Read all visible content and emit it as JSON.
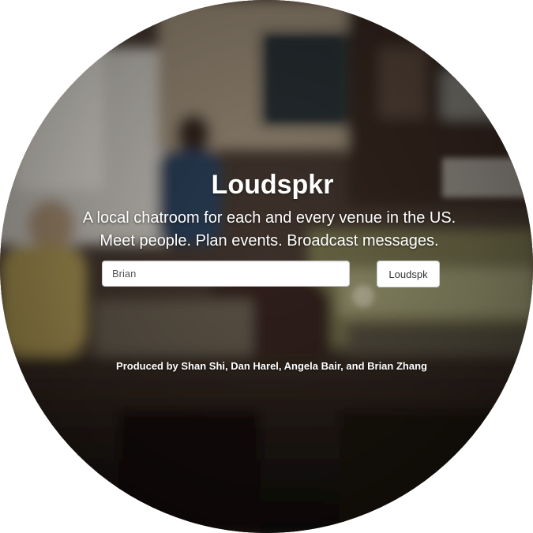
{
  "hero": {
    "title": "Loudspkr",
    "tagline_line1": "A local chatroom for each and every venue in the US.",
    "tagline_line2": "Meet people. Plan events. Broadcast messages."
  },
  "search": {
    "value": "Brian",
    "placeholder": "",
    "button_label": "Loudspk"
  },
  "footer": {
    "credits": "Produced by Shan Shi, Dan Harel, Angela Bair, and Brian Zhang"
  },
  "background": {
    "image": "blurred-cafe-photo"
  },
  "colors": {
    "text": "#ffffff",
    "input_bg": "#ffffff",
    "input_border": "#cccccc",
    "page_bg": "#ffffff"
  }
}
